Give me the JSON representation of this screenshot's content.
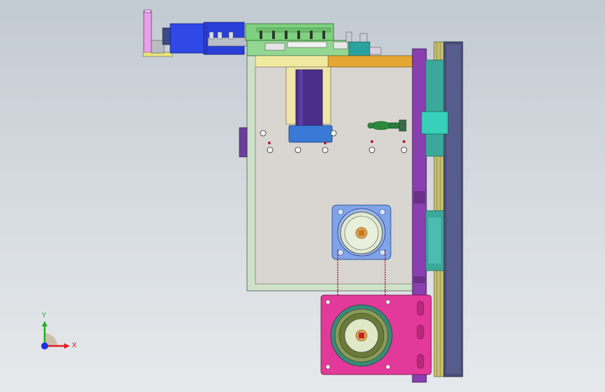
{
  "viewport": {
    "background_top": "#c2cad2",
    "background_bottom": "#e6e9ec"
  },
  "triad": {
    "x_label": "X",
    "y_label": "Y",
    "x_color": "#e02020",
    "y_color": "#20b020",
    "z_color": "#2030e0"
  },
  "model": {
    "colors": {
      "frame_plate": "#d9d6d2",
      "frame_border": "#a7c7a7",
      "top_bar": "#e4a832",
      "blue_motor": "#2f48e6",
      "green_rail": "#7fd07f",
      "purple_plate": "#8a3fb0",
      "dark_block": "#4a4f7a",
      "teal_block": "#3ec8b4",
      "pink_plate": "#e2399a",
      "pulley_green": "#8a9a5a",
      "motor_blue_light": "#7fa4ea"
    },
    "icons": [
      "coordinate-triad-icon",
      "hand-lever-icon",
      "motor-pulley-icon",
      "drive-pulley-icon"
    ]
  }
}
